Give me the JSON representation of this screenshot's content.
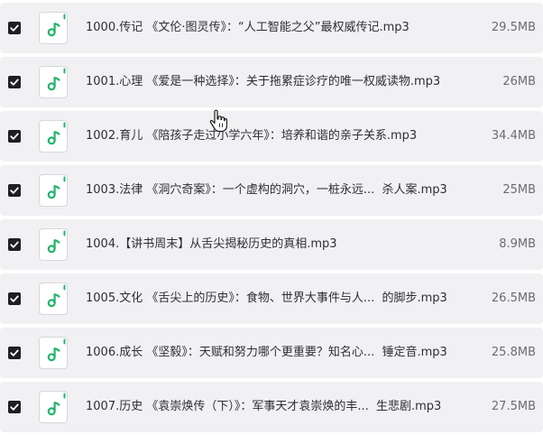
{
  "colors": {
    "row_background": "#f1f1f4",
    "checkbox_fill": "#1e1f24",
    "icon_accent": "#21b46d",
    "text": "#2e2f34",
    "size_text": "#6b6c72"
  },
  "icons": {
    "checkbox": "checkbox-checked-icon",
    "file": "audio-file-icon",
    "cursor": "hand-pointer-cursor"
  },
  "files": [
    {
      "checked": true,
      "name": "1000.传记 《文伦·图灵传》：“人工智能之父”最权威传记.mp3",
      "size": "29.5MB"
    },
    {
      "checked": true,
      "name": "1001.心理 《爱是一种选择》：关于拖累症诊疗的唯一权威读物.mp3",
      "size": "26MB"
    },
    {
      "checked": true,
      "name": "1002.育儿 《陪孩子走过小学六年》：培养和谐的亲子关系.mp3",
      "size": "34.4MB"
    },
    {
      "checked": true,
      "name": "1003.法律 《洞穴奇案》：一个虚构的洞穴，一桩永远...  杀人案.mp3",
      "size": "25MB"
    },
    {
      "checked": true,
      "name": "1004.【讲书周末】从舌尖揭秘历史的真相.mp3",
      "size": "8.9MB"
    },
    {
      "checked": true,
      "name": "1005.文化 《舌尖上的历史》：食物、世界大事件与人...  的脚步.mp3",
      "size": "26.5MB"
    },
    {
      "checked": true,
      "name": "1006.成长 《坚毅》：天赋和努力哪个更重要？知名心...  锤定音.mp3",
      "size": "25.8MB"
    },
    {
      "checked": true,
      "name": "1007.历史 《袁崇焕传（下）》：军事天才袁崇焕的丰...  生悲剧.mp3",
      "size": "27.5MB"
    }
  ]
}
